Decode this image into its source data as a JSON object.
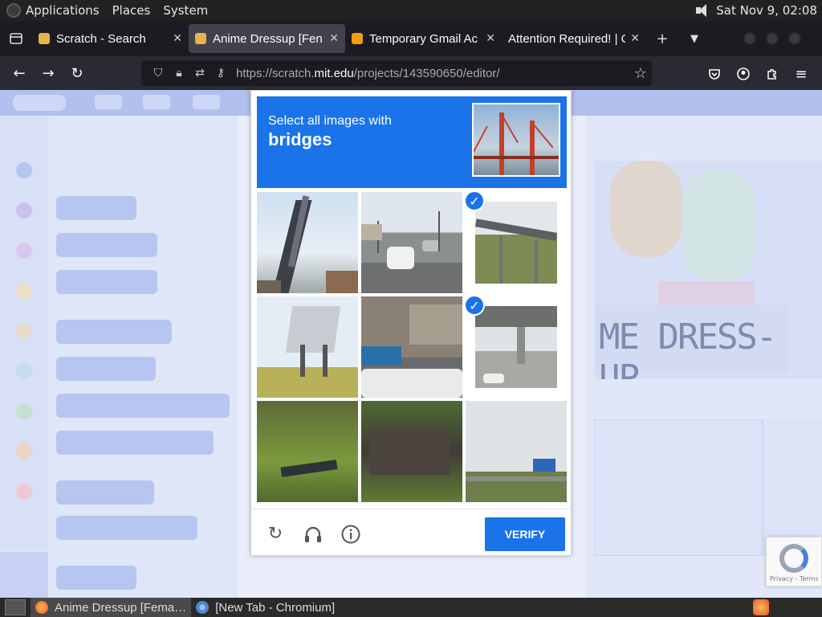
{
  "topbar": {
    "menus": [
      "Applications",
      "Places",
      "System"
    ],
    "clock": "Sat Nov 9, 02:08"
  },
  "tabs": [
    {
      "title": "Scratch - Search",
      "favicon_color": "#e8b34a",
      "active": false
    },
    {
      "title": "Anime Dressup [Fen",
      "favicon_color": "#e8b34a",
      "active": true
    },
    {
      "title": "Temporary Gmail Ac",
      "favicon_color": "#f29d0f",
      "active": false
    },
    {
      "title": "Attention Required! | Cl",
      "favicon_color": "",
      "active": false
    }
  ],
  "urlbar": {
    "prefix": "https://scratch.",
    "host": "mit.edu",
    "path": "/projects/143590650/editor/"
  },
  "captcha": {
    "instruction": "Select all images with",
    "target": "bridges",
    "verify_label": "VERIFY",
    "selected_tiles": [
      2,
      5
    ],
    "icons": [
      "reload-icon",
      "audio-icon",
      "info-icon"
    ]
  },
  "scratch": {
    "stage_title": "ME DRESS-UP"
  },
  "badge": {
    "text": "Privacy - Terms"
  },
  "taskbar": {
    "items": [
      {
        "title": "Anime Dressup [Fema…",
        "active": true
      },
      {
        "title": "[New Tab - Chromium]",
        "active": false
      }
    ]
  },
  "colors": {
    "accent": "#1a73e8",
    "page_overlay": "#e9eefa"
  }
}
